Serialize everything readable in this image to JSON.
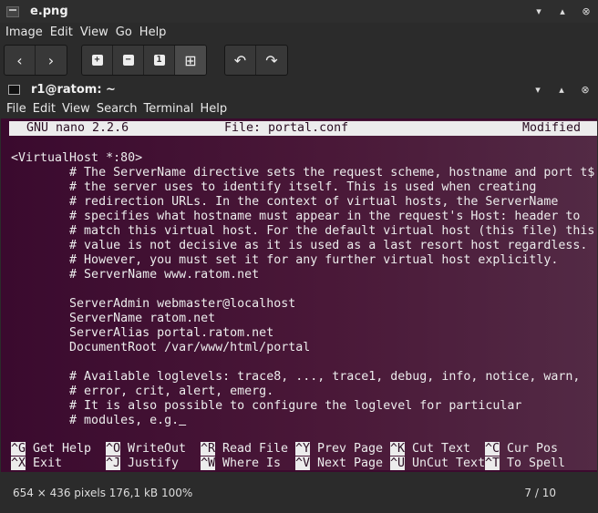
{
  "viewer": {
    "title": "e.png",
    "menu": [
      "Image",
      "Edit",
      "View",
      "Go",
      "Help"
    ],
    "status_info": "654 × 436 pixels  176,1 kB   100%",
    "counter": "7 / 10"
  },
  "terminal": {
    "title": "r1@ratom: ~",
    "menu": [
      "File",
      "Edit",
      "View",
      "Search",
      "Terminal",
      "Help"
    ]
  },
  "nano": {
    "version": "GNU nano 2.2.6",
    "file": "File: portal.conf",
    "state": "Modified",
    "lines": [
      "<VirtualHost *:80>",
      "        # The ServerName directive sets the request scheme, hostname and port t$",
      "        # the server uses to identify itself. This is used when creating",
      "        # redirection URLs. In the context of virtual hosts, the ServerName",
      "        # specifies what hostname must appear in the request's Host: header to",
      "        # match this virtual host. For the default virtual host (this file) this",
      "        # value is not decisive as it is used as a last resort host regardless.",
      "        # However, you must set it for any further virtual host explicitly.",
      "        # ServerName www.ratom.net",
      "",
      "        ServerAdmin webmaster@localhost",
      "        ServerName ratom.net",
      "        ServerAlias portal.ratom.net",
      "        DocumentRoot /var/www/html/portal",
      "",
      "        # Available loglevels: trace8, ..., trace1, debug, info, notice, warn,",
      "        # error, crit, alert, emerg.",
      "        # It is also possible to configure the loglevel for particular",
      "        # modules, e.g."
    ],
    "cursor_char": " ",
    "shortcuts": [
      [
        {
          "key": "^G",
          "label": "Get Help"
        },
        {
          "key": "^O",
          "label": "WriteOut"
        },
        {
          "key": "^R",
          "label": "Read File"
        },
        {
          "key": "^Y",
          "label": "Prev Page"
        },
        {
          "key": "^K",
          "label": "Cut Text"
        },
        {
          "key": "^C",
          "label": "Cur Pos"
        }
      ],
      [
        {
          "key": "^X",
          "label": "Exit"
        },
        {
          "key": "^J",
          "label": "Justify"
        },
        {
          "key": "^W",
          "label": "Where Is"
        },
        {
          "key": "^V",
          "label": "Next Page"
        },
        {
          "key": "^U",
          "label": "UnCut Text"
        },
        {
          "key": "^T",
          "label": "To Spell"
        }
      ]
    ]
  }
}
